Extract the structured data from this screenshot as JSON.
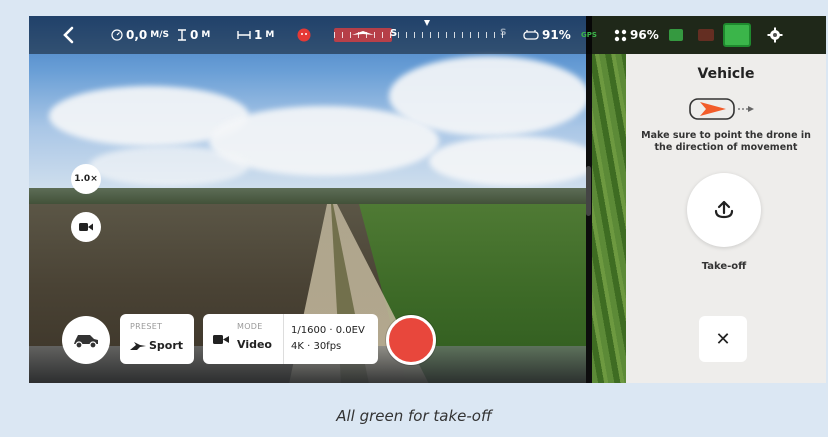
{
  "topbar": {
    "speed_value": "0,0",
    "speed_unit": "M/S",
    "altitude_value": "0",
    "altitude_unit": "M",
    "distance_value": "1",
    "distance_unit": "M",
    "heading_letter": "S",
    "heading_letter_right": "S",
    "controller_battery": "91%",
    "gps_label": "GPS",
    "drone_battery": "96%",
    "icons": [
      "back-icon",
      "speedometer-icon",
      "altitude-icon",
      "distance-icon",
      "alert-icon",
      "controller-icon",
      "propeller-icon",
      "settings-icon"
    ]
  },
  "left_controls": {
    "zoom_label": "1.0×",
    "camera_icon": "video-camera-icon"
  },
  "bottom": {
    "preset_label": "PRESET",
    "preset_value": "Sport",
    "mode_label": "MODE",
    "mode_value": "Video",
    "exposure": "1/1600 · 0.0EV",
    "resolution": "4K · 30fps"
  },
  "panel": {
    "title": "Vehicle",
    "hint": "Make sure to point the drone in the direction of movement",
    "takeoff_label": "Take-off",
    "close_symbol": "✕"
  },
  "caption": "All green for take-off",
  "colors": {
    "record": "#e8473c",
    "panel_bg": "#eeedeb",
    "status_green": "#3bb54a",
    "alert_red": "#e53935",
    "drone_orange": "#f25c2a"
  }
}
